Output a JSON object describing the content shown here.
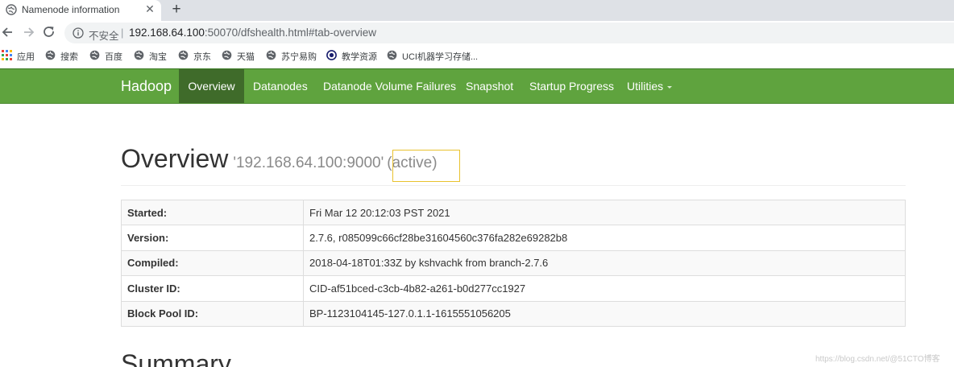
{
  "browser": {
    "tab": {
      "title": "Namenode information",
      "close_label": "✕"
    },
    "new_tab_label": "+",
    "address": {
      "security_label": "不安全",
      "separator": "|",
      "host": "192.168.64.100",
      "rest": ":50070/dfshealth.html#tab-overview"
    },
    "bookmarks": [
      {
        "label": "应用",
        "icon": "apps-grid-icon"
      },
      {
        "label": "搜索",
        "icon": "globe-icon"
      },
      {
        "label": "百度",
        "icon": "globe-icon"
      },
      {
        "label": "淘宝",
        "icon": "globe-icon"
      },
      {
        "label": "京东",
        "icon": "globe-icon"
      },
      {
        "label": "天猫",
        "icon": "globe-icon"
      },
      {
        "label": "苏宁易购",
        "icon": "globe-icon"
      },
      {
        "label": "教学资源",
        "icon": "radio-globe-icon"
      },
      {
        "label": "UCI机器学习存储...",
        "icon": "globe-icon"
      }
    ]
  },
  "navbar": {
    "brand": "Hadoop",
    "items": [
      {
        "label": "Overview",
        "active": true
      },
      {
        "label": "Datanodes"
      },
      {
        "label": "Datanode Volume Failures"
      },
      {
        "label": "Snapshot"
      },
      {
        "label": "Startup Progress"
      },
      {
        "label": "Utilities"
      }
    ]
  },
  "overview": {
    "title": "Overview",
    "address": "'192.168.64.100:9000'",
    "state": "(active)",
    "rows": [
      {
        "key": "Started:",
        "value": "Fri Mar 12 20:12:03 PST 2021"
      },
      {
        "key": "Version:",
        "value": "2.7.6, r085099c66cf28be31604560c376fa282e69282b8"
      },
      {
        "key": "Compiled:",
        "value": "2018-04-18T01:33Z by kshvachk from branch-2.7.6"
      },
      {
        "key": "Cluster ID:",
        "value": "CID-af51bced-c3cb-4b82-a261-b0d277cc1927"
      },
      {
        "key": "Block Pool ID:",
        "value": "BP-1123104145-127.0.1.1-1615551056205"
      }
    ]
  },
  "summary_title": "Summary",
  "watermark": "https://blog.csdn.net/@51CTO博客",
  "colors": {
    "navbar": "#5fa33e",
    "navbar_active": "#3f6b2a",
    "highlight": "#e9c22e"
  }
}
